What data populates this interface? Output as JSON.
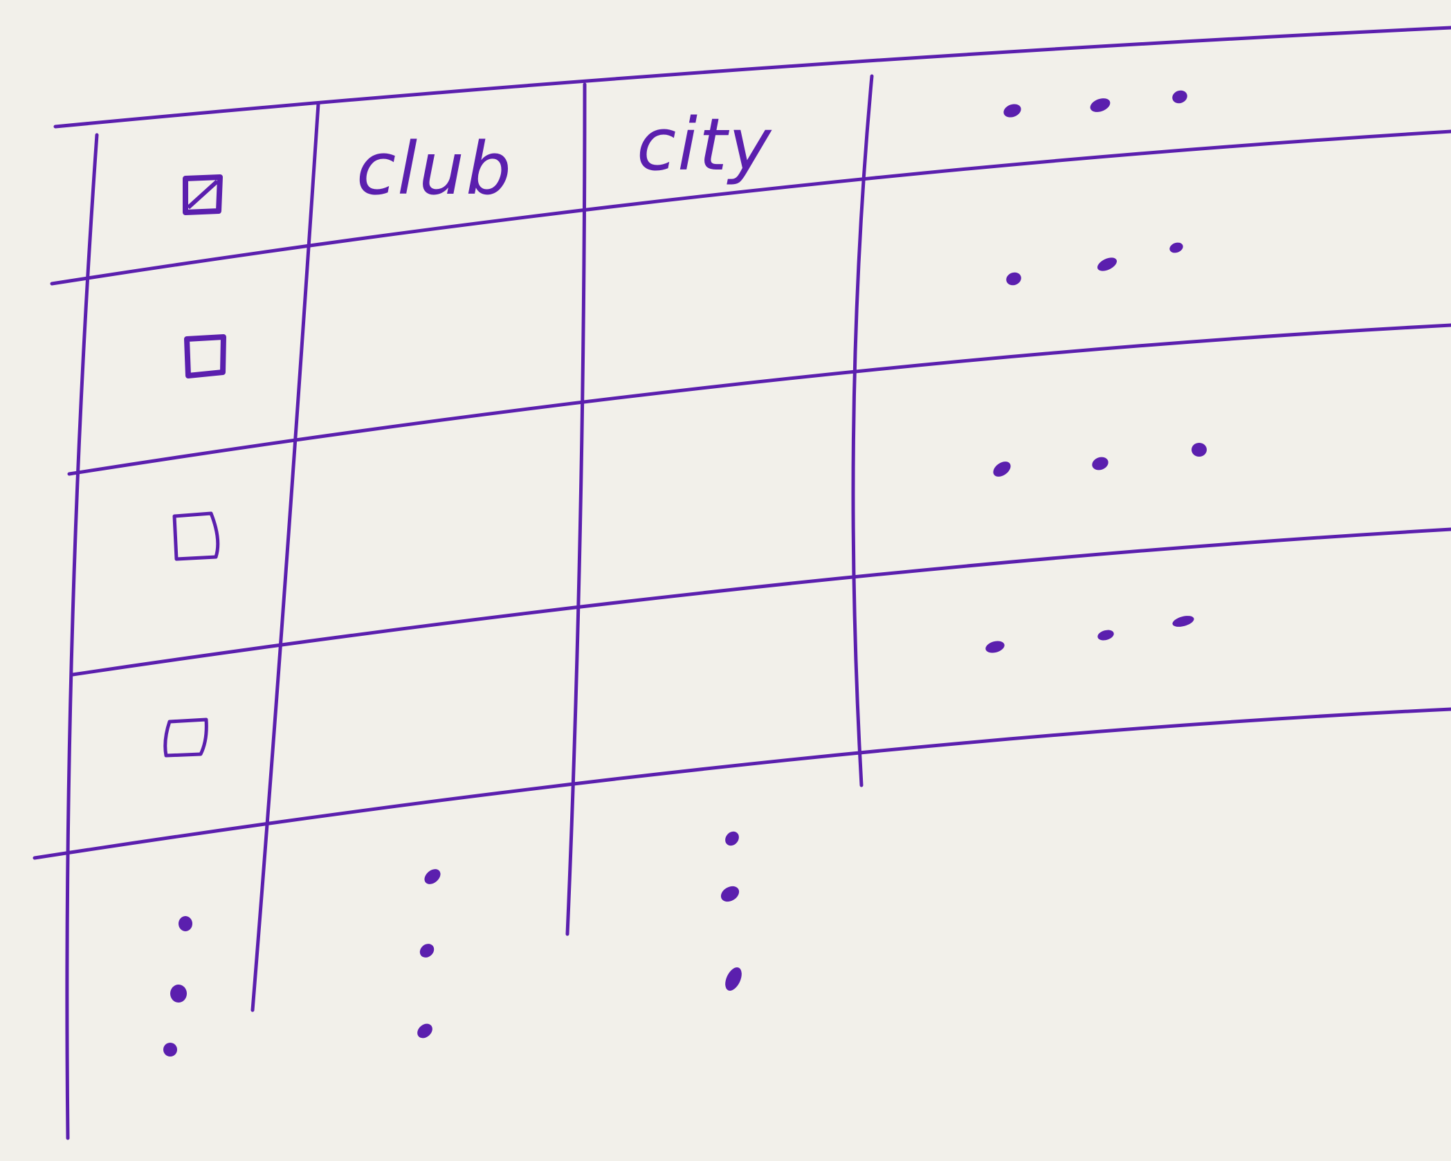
{
  "paper": {
    "background": "#f2f0ea",
    "ink_color": "#5b1fae"
  },
  "table": {
    "columns": [
      {
        "key": "select",
        "header": "",
        "header_icon": "checkbox-checked-icon"
      },
      {
        "key": "club",
        "header": "club"
      },
      {
        "key": "city",
        "header": "city"
      },
      {
        "key": "actions",
        "header": "",
        "header_icon": "more-horizontal-icon"
      }
    ],
    "rows": [
      {
        "checkbox": "checkbox-empty-icon",
        "club": "",
        "city": "",
        "action_icon": "more-horizontal-icon"
      },
      {
        "checkbox": "checkbox-empty-icon",
        "club": "",
        "city": "",
        "action_icon": "more-horizontal-icon"
      },
      {
        "checkbox": "checkbox-empty-icon",
        "club": "",
        "city": "",
        "action_icon": "more-horizontal-icon"
      }
    ],
    "continuation_icon": "more-vertical-icon"
  }
}
